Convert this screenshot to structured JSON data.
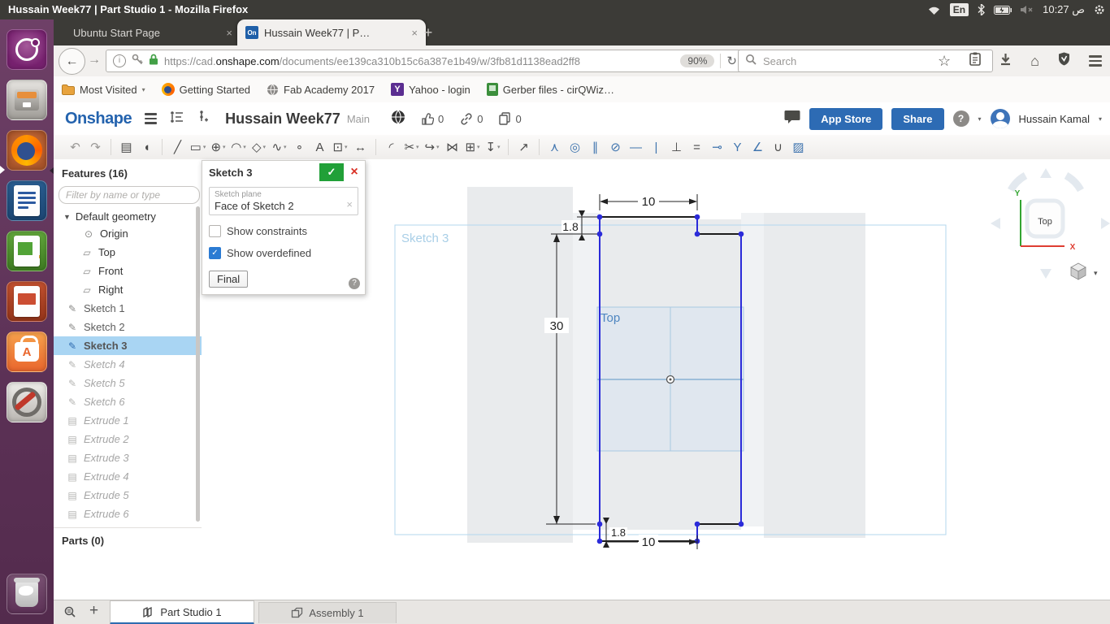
{
  "desktop": {
    "top_bar": {
      "title": "Hussain Week77 | Part Studio 1 - Mozilla Firefox",
      "keyboard_layout": "En",
      "time": "ص 10:27"
    },
    "launcher": {
      "items": [
        "ubuntu-dash-icon",
        "files-icon",
        "firefox-icon",
        "libreoffice-writer-icon",
        "libreoffice-calc-icon",
        "libreoffice-impress-icon",
        "software-center-icon",
        "system-settings-icon",
        "trash-icon"
      ]
    }
  },
  "browser": {
    "tabs": {
      "tab1": "Ubuntu Start Page",
      "tab2": "Hussain Week77 | P…",
      "tab2_icon": "On",
      "close": "×",
      "new_tab": "+"
    },
    "nav": {
      "url_scheme": "https://cad.",
      "url_domain": "onshape.com",
      "url_path": "/documents/ee139ca310b15c6a387e1b49/w/3fb81d1138ead2ff8",
      "zoom_badge": "90%",
      "search_placeholder": "Search"
    },
    "bookmarks": {
      "b1": "Most Visited",
      "b2": "Getting Started",
      "b3": "Fab Academy 2017",
      "b4": "Yahoo - login",
      "b4_icon": "Y",
      "b5": "Gerber files - cirQWiz…"
    }
  },
  "onshape": {
    "header": {
      "logo": "Onshape",
      "document_title": "Hussain Week77",
      "workspace": "Main",
      "like_count": "0",
      "link_count": "0",
      "copy_count": "0",
      "app_store_label": "App Store",
      "share_label": "Share",
      "user_name": "Hussain Kamal"
    },
    "toolbar": {
      "tools": [
        {
          "name": "undo-icon",
          "glyph": "↶",
          "cls": "muted"
        },
        {
          "name": "redo-icon",
          "glyph": "↷",
          "cls": "muted"
        },
        {
          "divider": true
        },
        {
          "name": "sketch-icon",
          "glyph": "▤"
        },
        {
          "name": "sketch-region-icon",
          "glyph": "◖"
        },
        {
          "divider": true
        },
        {
          "name": "line-tool-icon",
          "glyph": "╱"
        },
        {
          "name": "rectangle-tool-icon",
          "glyph": "▭",
          "caret": true
        },
        {
          "name": "circle-tool-icon",
          "glyph": "⊕",
          "caret": true
        },
        {
          "name": "arc-tool-icon",
          "glyph": "◠",
          "caret": true
        },
        {
          "name": "polygon-tool-icon",
          "glyph": "◇",
          "caret": true
        },
        {
          "name": "spline-tool-icon",
          "glyph": "∿",
          "caret": true
        },
        {
          "name": "point-tool-icon",
          "glyph": "∘"
        },
        {
          "name": "text-tool-icon",
          "glyph": "A"
        },
        {
          "name": "offset-tool-icon",
          "glyph": "⊡",
          "caret": true
        },
        {
          "name": "dimension-tool-icon",
          "glyph": "↔"
        },
        {
          "divider": true
        },
        {
          "name": "fillet-tool-icon",
          "glyph": "◜"
        },
        {
          "name": "trim-tool-icon",
          "glyph": "✂",
          "caret": true
        },
        {
          "name": "extend-tool-icon",
          "glyph": "↪",
          "caret": true
        },
        {
          "name": "mirror-tool-icon",
          "glyph": "⋈"
        },
        {
          "name": "pattern-tool-icon",
          "glyph": "⊞",
          "caret": true
        },
        {
          "name": "import-dxf-icon",
          "glyph": "↧",
          "caret": true
        },
        {
          "divider": true
        },
        {
          "name": "measure-icon",
          "glyph": "↗"
        },
        {
          "divider": true
        },
        {
          "name": "coincident-constraint-icon",
          "glyph": "⋏",
          "cls": "blue"
        },
        {
          "name": "concentric-constraint-icon",
          "glyph": "◎",
          "cls": "blue"
        },
        {
          "name": "parallel-constraint-icon",
          "glyph": "∥",
          "cls": "blue"
        },
        {
          "name": "tangent-constraint-icon",
          "glyph": "⊘",
          "cls": "blue"
        },
        {
          "name": "horizontal-constraint-icon",
          "glyph": "—",
          "cls": "blue"
        },
        {
          "name": "vertical-constraint-icon",
          "glyph": "|",
          "cls": "blue"
        },
        {
          "name": "perpendicular-constraint-icon",
          "glyph": "⊥"
        },
        {
          "name": "equal-constraint-icon",
          "glyph": "="
        },
        {
          "name": "midpoint-constraint-icon",
          "glyph": "⊸",
          "cls": "blue"
        },
        {
          "name": "symmetric-constraint-icon",
          "glyph": "Y",
          "cls": "blue"
        },
        {
          "name": "normal-constraint-icon",
          "glyph": "∠",
          "cls": "blue"
        },
        {
          "name": "curvature-constraint-icon",
          "glyph": "∪"
        },
        {
          "name": "fix-constraint-icon",
          "glyph": "▨",
          "cls": "blue"
        }
      ]
    },
    "features_panel": {
      "title": "Features (16)",
      "filter_placeholder": "Filter by name or type",
      "group_label": "Default geometry",
      "items": [
        {
          "label": "Origin",
          "glyph": "⊙",
          "icon": "origin",
          "state": "normal",
          "indent": 36
        },
        {
          "label": "Top",
          "glyph": "▱",
          "icon": "plane",
          "state": "normal",
          "indent": 34
        },
        {
          "label": "Front",
          "glyph": "▱",
          "icon": "plane",
          "state": "normal",
          "indent": 34
        },
        {
          "label": "Right",
          "glyph": "▱",
          "icon": "plane",
          "state": "normal",
          "indent": 34
        },
        {
          "label": "Sketch 1",
          "glyph": "✎",
          "icon": "sketch",
          "state": "dim",
          "indent": 16
        },
        {
          "label": "Sketch 2",
          "glyph": "✎",
          "icon": "sketch",
          "state": "dim",
          "indent": 16
        },
        {
          "label": "Sketch 3",
          "glyph": "✎",
          "icon": "sketch",
          "state": "selected",
          "indent": 16
        },
        {
          "label": "Sketch 4",
          "glyph": "✎",
          "icon": "sketch",
          "state": "suppressed",
          "indent": 16
        },
        {
          "label": "Sketch 5",
          "glyph": "✎",
          "icon": "sketch",
          "state": "suppressed",
          "indent": 16
        },
        {
          "label": "Sketch 6",
          "glyph": "✎",
          "icon": "sketch",
          "state": "suppressed",
          "indent": 16
        },
        {
          "label": "Extrude 1",
          "glyph": "▤",
          "icon": "extrude",
          "state": "suppressed",
          "indent": 16
        },
        {
          "label": "Extrude 2",
          "glyph": "▤",
          "icon": "extrude",
          "state": "suppressed",
          "indent": 16
        },
        {
          "label": "Extrude 3",
          "glyph": "▤",
          "icon": "extrude",
          "state": "suppressed",
          "indent": 16
        },
        {
          "label": "Extrude 4",
          "glyph": "▤",
          "icon": "extrude",
          "state": "suppressed",
          "indent": 16
        },
        {
          "label": "Extrude 5",
          "glyph": "▤",
          "icon": "extrude",
          "state": "suppressed",
          "indent": 16
        },
        {
          "label": "Extrude 6",
          "glyph": "▤",
          "icon": "extrude",
          "state": "suppressed",
          "indent": 16
        }
      ],
      "parts_label": "Parts (0)"
    },
    "sketch_dialog": {
      "title": "Sketch 3",
      "plane_field_label": "Sketch plane",
      "plane_value": "Face of Sketch 2",
      "show_constraints_label": "Show constraints",
      "show_constraints_checked": false,
      "show_overdefined_label": "Show overdefined",
      "show_overdefined_checked": true,
      "final_label": "Final",
      "confirm": "✓",
      "close": "×"
    },
    "canvas": {
      "sketch_frame_label": "Sketch 3",
      "plane_label": "Top",
      "dim_width_top": "10",
      "dim_width_bottom": "10",
      "dim_height": "30",
      "dim_step_top": "1.8",
      "dim_step_bottom": "1.8",
      "viewcube_face": "Top",
      "axis_x": "X",
      "axis_y": "Y"
    },
    "bottom_tabs": {
      "tab1": "Part Studio 1",
      "tab2": "Assembly 1"
    }
  }
}
